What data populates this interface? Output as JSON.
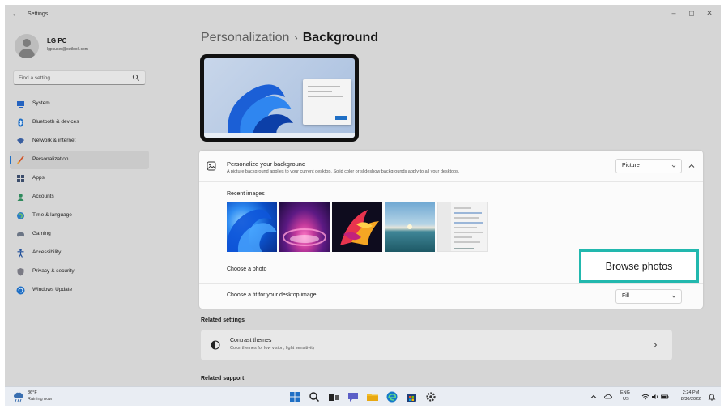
{
  "window": {
    "back_glyph": "←",
    "title": "Settings",
    "minimize_glyph": "–",
    "maximize_glyph": "◻",
    "close_glyph": "✕"
  },
  "profile": {
    "name": "LG PC",
    "email": "lgpcuser@outlook.com"
  },
  "search": {
    "placeholder": "Find a setting"
  },
  "sidebar": {
    "items": [
      {
        "label": "System",
        "icon": "system-icon",
        "active": false
      },
      {
        "label": "Bluetooth & devices",
        "icon": "bluetooth-icon",
        "active": false
      },
      {
        "label": "Network & internet",
        "icon": "network-icon",
        "active": false
      },
      {
        "label": "Personalization",
        "icon": "personalization-brush-icon",
        "active": true
      },
      {
        "label": "Apps",
        "icon": "apps-icon",
        "active": false
      },
      {
        "label": "Accounts",
        "icon": "accounts-icon",
        "active": false
      },
      {
        "label": "Time & language",
        "icon": "time-language-icon",
        "active": false
      },
      {
        "label": "Gaming",
        "icon": "gaming-icon",
        "active": false
      },
      {
        "label": "Accessibility",
        "icon": "accessibility-icon",
        "active": false
      },
      {
        "label": "Privacy & security",
        "icon": "privacy-shield-icon",
        "active": false
      },
      {
        "label": "Windows Update",
        "icon": "windows-update-icon",
        "active": false
      }
    ]
  },
  "breadcrumb": {
    "parent": "Personalization",
    "separator": "›",
    "current": "Background"
  },
  "background_panel": {
    "title": "Personalize your background",
    "description": "A picture background applies to your current desktop. Solid color or slideshow backgrounds apply to all your desktops.",
    "type_value": "Picture",
    "recent_images_label": "Recent images",
    "choose_photo_label": "Choose a photo",
    "browse_label": "Browse photos",
    "fit_label": "Choose a fit for your desktop image",
    "fit_value": "Fill"
  },
  "related_settings": {
    "heading": "Related settings",
    "contrast_title": "Contrast themes",
    "contrast_desc": "Color themes for low vision, light sensitivity"
  },
  "related_support": {
    "heading": "Related support"
  },
  "taskbar": {
    "weather_temp": "86°F",
    "weather_cond": "Raining now",
    "lang_top": "ENG",
    "lang_bottom": "US",
    "time": "2:24 PM",
    "date": "8/30/2022"
  },
  "colors": {
    "accent": "#1f6fc5",
    "highlight_border": "#22b8ae",
    "window_bg": "#d6d6d6"
  }
}
